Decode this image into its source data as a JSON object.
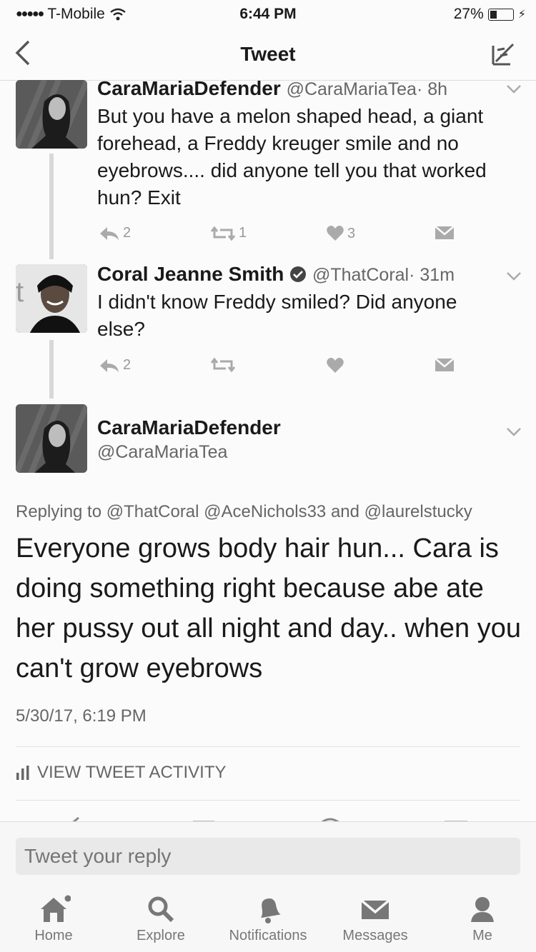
{
  "status": {
    "carrier": "T-Mobile",
    "time": "6:44 PM",
    "battery": "27%"
  },
  "nav": {
    "title": "Tweet"
  },
  "tweets": [
    {
      "name": "CaraMariaDefender",
      "handle": "@CaraMariaTea",
      "age": "· 8h",
      "text": "But you have a melon shaped head, a giant forehead, a Freddy kreuger smile and no eyebrows.... did anyone tell you that worked hun? Exit",
      "replies": "2",
      "retweets": "1",
      "likes": "3"
    },
    {
      "name": "Coral Jeanne Smith",
      "handle": "@ThatCoral",
      "age": "· 31m",
      "text": "I didn't know Freddy smiled? Did anyone else?",
      "replies": "2",
      "retweets": "",
      "likes": ""
    }
  ],
  "main": {
    "name": "CaraMariaDefender",
    "handle": "@CaraMariaTea",
    "replying_prefix": "Replying to",
    "replying_1": "@ThatCoral",
    "replying_2": "@AceNichols33",
    "replying_and": "and",
    "replying_3": "@laurelstucky",
    "text": "Everyone grows body hair hun... Cara is doing something right because abe ate her pussy out all night and day.. when you can't grow eyebrows",
    "timestamp": "5/30/17, 6:19 PM",
    "activity": "VIEW TWEET ACTIVITY"
  },
  "reply": {
    "placeholder": "Tweet your reply"
  },
  "tabs": {
    "home": "Home",
    "explore": "Explore",
    "notifications": "Notifications",
    "messages": "Messages",
    "me": "Me"
  },
  "colors": {
    "verified": "#444444",
    "text": "#1a1a1a",
    "muted": "#666666"
  }
}
